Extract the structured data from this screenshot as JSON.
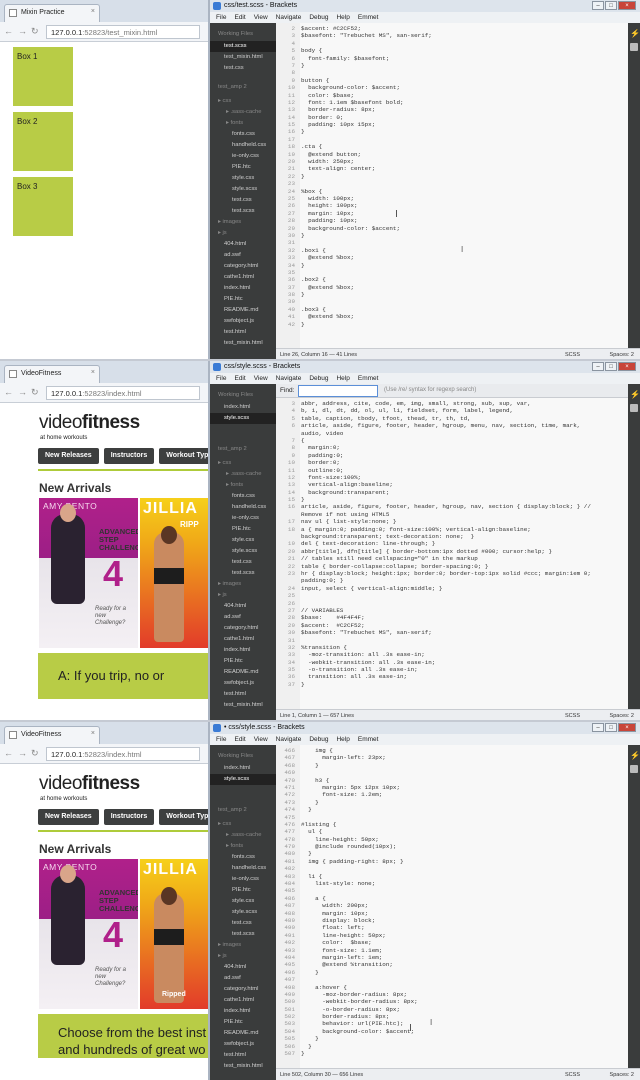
{
  "frames": [
    {
      "browser": {
        "tab_title": "Mixin Practice",
        "url_host": "127.0.0.1",
        "url_rest": ":52823/test_mixin.html",
        "boxes": [
          "Box 1",
          "Box 2",
          "Box 3"
        ]
      },
      "editor": {
        "title": "css/test.scss - Brackets",
        "working_files": [
          "test.scss",
          "test_mixin.html",
          "test.css"
        ],
        "status": "Line 26, Column 16 — 41 Lines",
        "mode": "SCSS",
        "spaces": "Spaces: 2"
      }
    },
    {
      "browser": {
        "tab_title": "VideoFitness",
        "url_host": "127.0.0.1",
        "url_rest": ":52823/index.html",
        "logo_light": "video",
        "logo_bold": "fitness",
        "tagline": "at home workouts",
        "nav": [
          "New Releases",
          "Instructors",
          "Workout Type"
        ],
        "heading": "New Arrivals",
        "dvd1_name": "AMY BENTO",
        "dvd1_text": "ADVANCED STEP CHALLENGE",
        "dvd1_num": "4",
        "dvd1_ready": "Ready for a new Challenge?",
        "dvd2_name": "JILLIA",
        "dvd2_sub": "RIPP",
        "banner": "A: If you trip, no or"
      },
      "editor": {
        "title": "css/style.scss - Brackets",
        "working_files": [
          "index.html",
          "style.scss"
        ],
        "find_label": "Find:",
        "find_hint": "(Use /re/ syntax for regexp search)",
        "status": "Line 1, Column 1 — 657 Lines",
        "mode": "SCSS",
        "spaces": "Spaces: 2"
      }
    },
    {
      "browser": {
        "tab_title": "VideoFitness",
        "url_host": "127.0.0.1",
        "url_rest": ":52823/index.html",
        "logo_light": "video",
        "logo_bold": "fitness",
        "tagline": "at home workouts",
        "nav": [
          "New Releases",
          "Instructors",
          "Workout Type"
        ],
        "heading": "New Arrivals",
        "dvd1_name": "AMY BENTO",
        "dvd1_text": "ADVANCED STEP CHALLENGE",
        "dvd1_num": "4",
        "dvd1_ready": "Ready for a new Challenge?",
        "dvd2_name": "JILLIA",
        "dvd2_sub": "Ripped",
        "banner_line1": "Choose from the best inst",
        "banner_line2": "and hundreds of great wo"
      },
      "editor": {
        "title": "• css/style.scss - Brackets",
        "working_files": [
          "index.html",
          "style.scss"
        ],
        "status": "Line 502, Column 30 — 656 Lines",
        "mode": "SCSS",
        "spaces": "Spaces: 2"
      }
    }
  ],
  "menu": [
    "File",
    "Edit",
    "View",
    "Navigate",
    "Debug",
    "Help",
    "Emmet"
  ],
  "sidebar_labels": {
    "working_files": "Working Files",
    "project": "test_amp 2"
  },
  "project_tree": [
    {
      "n": "css",
      "t": "folder"
    },
    {
      "n": ".sass-cache",
      "t": "folder2"
    },
    {
      "n": "fonts",
      "t": "folder2"
    },
    {
      "n": "fonts.css",
      "t": "file2"
    },
    {
      "n": "handheld.css",
      "t": "file2"
    },
    {
      "n": "ie-only.css",
      "t": "file2"
    },
    {
      "n": "PIE.htc",
      "t": "file2"
    },
    {
      "n": "style.css",
      "t": "file2"
    },
    {
      "n": "style.scss",
      "t": "file2"
    },
    {
      "n": "test.css",
      "t": "file2"
    },
    {
      "n": "test.scss",
      "t": "file2"
    },
    {
      "n": "images",
      "t": "folder"
    },
    {
      "n": "js",
      "t": "folder"
    },
    {
      "n": "404.html",
      "t": "file"
    },
    {
      "n": "ad.swf",
      "t": "file"
    },
    {
      "n": "category.html",
      "t": "file"
    },
    {
      "n": "cathe1.html",
      "t": "file"
    },
    {
      "n": "index.html",
      "t": "file"
    },
    {
      "n": "PIE.htc",
      "t": "file"
    },
    {
      "n": "README.md",
      "t": "file"
    },
    {
      "n": "swfobject.js",
      "t": "file"
    },
    {
      "n": "test.html",
      "t": "file"
    },
    {
      "n": "test_mixin.html",
      "t": "file"
    }
  ],
  "code": [
    [
      [
        "2",
        "$accent: #C2CF52;"
      ],
      [
        "3",
        "$basefont: \"Trebuchet MS\", san-serif;"
      ],
      [
        "4",
        ""
      ],
      [
        "5",
        "body {"
      ],
      [
        "6",
        "  font-family: $basefont;"
      ],
      [
        "7",
        "}"
      ],
      [
        "8",
        ""
      ],
      [
        "9",
        "button {"
      ],
      [
        "10",
        "  background-color: $accent;"
      ],
      [
        "11",
        "  color: $base;"
      ],
      [
        "12",
        "  font: 1.1em $basefont bold;"
      ],
      [
        "13",
        "  border-radius: 8px;"
      ],
      [
        "14",
        "  border: 0;"
      ],
      [
        "15",
        "  padding: 10px 15px;"
      ],
      [
        "16",
        "}"
      ],
      [
        "17",
        ""
      ],
      [
        "18",
        ".cta {"
      ],
      [
        "19",
        "  @extend button;"
      ],
      [
        "20",
        "  width: 250px;"
      ],
      [
        "21",
        "  text-align: center;"
      ],
      [
        "22",
        "}"
      ],
      [
        "23",
        ""
      ],
      [
        "24",
        "%box {"
      ],
      [
        "25",
        "  width: 100px;"
      ],
      [
        "26",
        "  height: 100px;"
      ],
      [
        "27",
        "  margin: 10px;"
      ],
      [
        "28",
        "  padding: 10px;"
      ],
      [
        "29",
        "  background-color: $accent;"
      ],
      [
        "30",
        "}"
      ],
      [
        "31",
        ""
      ],
      [
        "32",
        ".box1 {"
      ],
      [
        "33",
        "  @extend %box;"
      ],
      [
        "34",
        "}"
      ],
      [
        "35",
        ""
      ],
      [
        "36",
        ".box2 {"
      ],
      [
        "37",
        "  @extend %box;"
      ],
      [
        "38",
        "}"
      ],
      [
        "39",
        ""
      ],
      [
        "40",
        ".box3 {"
      ],
      [
        "41",
        "  @extend %box;"
      ],
      [
        "42",
        "}"
      ]
    ],
    [
      [
        "3",
        "abbr, address, cite, code, em, img, small, strong, sub, sup, var,"
      ],
      [
        "4",
        "b, i, dl, dt, dd, ol, ul, li, fieldset, form, label, legend,"
      ],
      [
        "5",
        "table, caption, tbody, tfoot, thead, tr, th, td,"
      ],
      [
        "6",
        "article, aside, figure, footer, header, hgroup, menu, nav, section, time, mark,"
      ],
      [
        "",
        "audio, video"
      ],
      [
        "7",
        "{"
      ],
      [
        "8",
        "  margin:0;"
      ],
      [
        "9",
        "  padding:0;"
      ],
      [
        "10",
        "  border:0;"
      ],
      [
        "11",
        "  outline:0;"
      ],
      [
        "12",
        "  font-size:100%;"
      ],
      [
        "13",
        "  vertical-align:baseline;"
      ],
      [
        "14",
        "  background:transparent;"
      ],
      [
        "15",
        "}"
      ],
      [
        "16",
        "article, aside, figure, footer, header, hgroup, nav, section { display:block; } //"
      ],
      [
        "",
        "Remove if not using HTML5"
      ],
      [
        "17",
        "nav ul { list-style:none; }"
      ],
      [
        "18",
        "a { margin:0; padding:0; font-size:100%; vertical-align:baseline;"
      ],
      [
        "",
        "background:transparent; text-decoration: none;  }"
      ],
      [
        "19",
        "del { text-decoration: line-through; }"
      ],
      [
        "20",
        "abbr[title], dfn[title] { border-bottom:1px dotted #000; cursor:help; }"
      ],
      [
        "21",
        "// tables still need cellspacing=\"0\" in the markup"
      ],
      [
        "22",
        "table { border-collapse:collapse; border-spacing:0; }"
      ],
      [
        "23",
        "hr { display:block; height:1px; border:0; border-top:1px solid #ccc; margin:1em 0;"
      ],
      [
        "",
        "padding:0; }"
      ],
      [
        "24",
        "input, select { vertical-align:middle; }"
      ],
      [
        "25",
        ""
      ],
      [
        "26",
        ""
      ],
      [
        "27",
        "// VARIABLES"
      ],
      [
        "28",
        "$base:    #4F4F4F;"
      ],
      [
        "29",
        "$accent:  #C2CF52;"
      ],
      [
        "30",
        "$basefont: \"Trebuchet MS\", san-serif;"
      ],
      [
        "31",
        ""
      ],
      [
        "32",
        "%transition {"
      ],
      [
        "33",
        "  -moz-transition: all .3s ease-in;"
      ],
      [
        "34",
        "  -webkit-transition: all .3s ease-in;"
      ],
      [
        "35",
        "  -o-transition: all .3s ease-in;"
      ],
      [
        "36",
        "  transition: all .3s ease-in;"
      ],
      [
        "37",
        "}"
      ]
    ],
    [
      [
        "466",
        "    img {"
      ],
      [
        "467",
        "      margin-left: 23px;"
      ],
      [
        "468",
        "    }"
      ],
      [
        "469",
        ""
      ],
      [
        "470",
        "    h3 {"
      ],
      [
        "471",
        "      margin: 5px 12px 10px;"
      ],
      [
        "472",
        "      font-size: 1.2em;"
      ],
      [
        "473",
        "    }"
      ],
      [
        "474",
        "  }"
      ],
      [
        "475",
        ""
      ],
      [
        "476",
        "#listing {"
      ],
      [
        "477",
        "  ul {"
      ],
      [
        "478",
        "    line-height: 50px;"
      ],
      [
        "479",
        "    @include rounded(10px);"
      ],
      [
        "480",
        "  }"
      ],
      [
        "481",
        "  img { padding-right: 8px; }"
      ],
      [
        "482",
        ""
      ],
      [
        "483",
        "  li {"
      ],
      [
        "484",
        "    list-style: none;"
      ],
      [
        "485",
        ""
      ],
      [
        "486",
        "    a {"
      ],
      [
        "487",
        "      width: 200px;"
      ],
      [
        "488",
        "      margin: 10px;"
      ],
      [
        "489",
        "      display: block;"
      ],
      [
        "490",
        "      float: left;"
      ],
      [
        "491",
        "      line-height: 50px;"
      ],
      [
        "492",
        "      color:  $base;"
      ],
      [
        "493",
        "      font-size: 1.1em;"
      ],
      [
        "494",
        "      margin-left: 1em;"
      ],
      [
        "495",
        "      @extend %transition;"
      ],
      [
        "496",
        "    }"
      ],
      [
        "497",
        ""
      ],
      [
        "498",
        "    a:hover {"
      ],
      [
        "499",
        "      -moz-border-radius: 8px;"
      ],
      [
        "500",
        "      -webkit-border-radius: 8px;"
      ],
      [
        "501",
        "      -o-border-radius: 8px;"
      ],
      [
        "502",
        "      border-radius: 8px;"
      ],
      [
        "503",
        "      behavior: url(PIE.htc);"
      ],
      [
        "504",
        "      background-color: $accent;"
      ],
      [
        "505",
        "    }"
      ],
      [
        "506",
        "  }"
      ],
      [
        "507",
        "}"
      ]
    ]
  ]
}
